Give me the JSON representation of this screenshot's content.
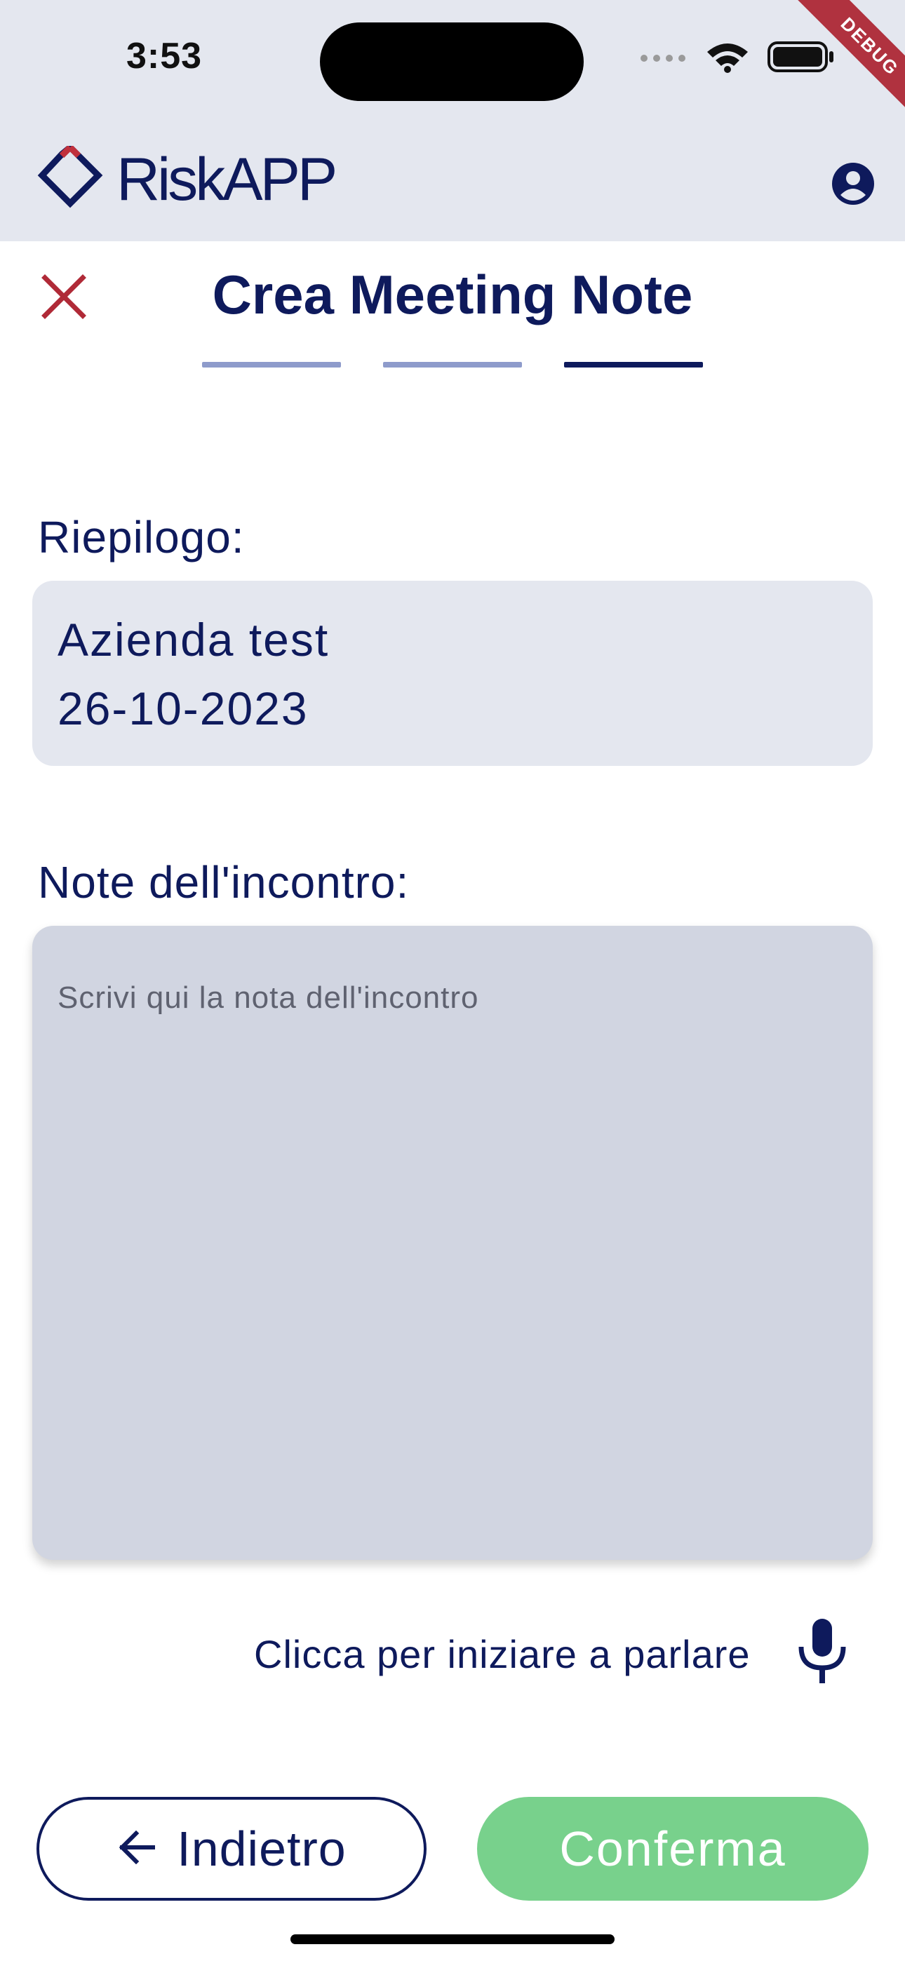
{
  "status_bar": {
    "time": "3:53",
    "signal_icon": "cellular-signal-icon",
    "wifi_icon": "wifi-icon",
    "battery_icon": "battery-icon"
  },
  "debug_banner": {
    "label": "DEBUG"
  },
  "header": {
    "brand": "RiskAPP",
    "logo_icon": "riskapp-logo-icon",
    "account_icon": "account-circle-icon"
  },
  "page": {
    "title": "Crea Meeting Note",
    "close_icon": "close-icon",
    "steps_total": 3,
    "current_step": 3
  },
  "summary": {
    "label": "Riepilogo:",
    "company": "Azienda test",
    "date": "26-10-2023"
  },
  "notes": {
    "label": "Note dell'incontro:",
    "value": "",
    "placeholder": "Scrivi qui la nota dell'incontro"
  },
  "voice": {
    "prompt": "Clicca per iniziare a parlare",
    "icon": "microphone-icon"
  },
  "actions": {
    "back_label": "Indietro",
    "back_icon": "arrow-left-icon",
    "confirm_label": "Conferma"
  },
  "colors": {
    "primary": "#0e1a5c",
    "header_bg": "#e4e7ef",
    "step_inactive": "#8e9bcb",
    "close": "#b02a37",
    "confirm": "#78d18c",
    "debug": "#b0323f"
  }
}
